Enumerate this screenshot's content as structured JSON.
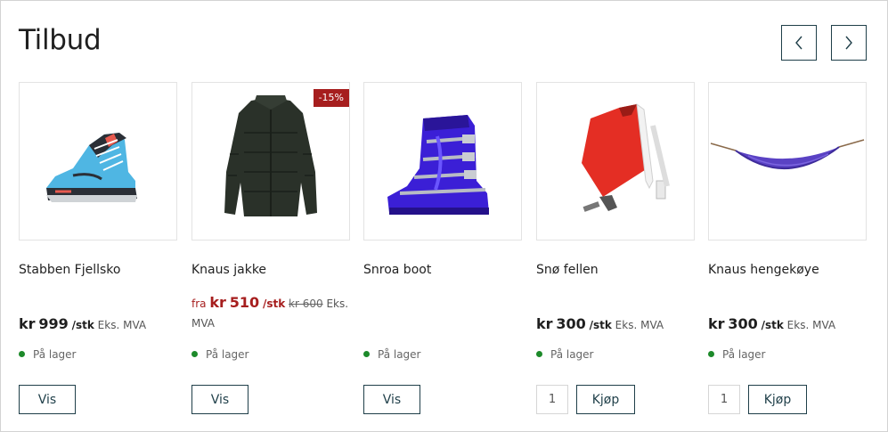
{
  "section": {
    "title": "Tilbud"
  },
  "nav": {
    "prev_icon": "chevron-left-icon",
    "next_icon": "chevron-right-icon"
  },
  "products": [
    {
      "name": "Stabben Fjellsko",
      "currency": "kr",
      "price": "999",
      "unit": "/stk",
      "vat": "Eks. MVA",
      "stock": "På lager",
      "action": "Vis",
      "image": "hiking-boot"
    },
    {
      "name": "Knaus jakke",
      "from": "fra",
      "currency": "kr",
      "price": "510",
      "unit": "/stk",
      "old_price": "kr 600",
      "vat": "Eks. MVA",
      "stock": "På lager",
      "action": "Vis",
      "badge": "-15%",
      "image": "jacket"
    },
    {
      "name": "Snroa boot",
      "stock": "På lager",
      "action": "Vis",
      "image": "ski-boot"
    },
    {
      "name": "Snø fellen",
      "currency": "kr",
      "price": "300",
      "unit": "/stk",
      "vat": "Eks. MVA",
      "stock": "På lager",
      "qty": "1",
      "action": "Kjøp",
      "image": "climbing-skins"
    },
    {
      "name": "Knaus hengekøye",
      "currency": "kr",
      "price": "300",
      "unit": "/stk",
      "vat": "Eks. MVA",
      "stock": "På lager",
      "qty": "1",
      "action": "Kjøp",
      "image": "hammock"
    }
  ],
  "colors": {
    "accent": "#1f3f49",
    "sale": "#a61e1e",
    "in_stock": "#1d8a2a"
  }
}
